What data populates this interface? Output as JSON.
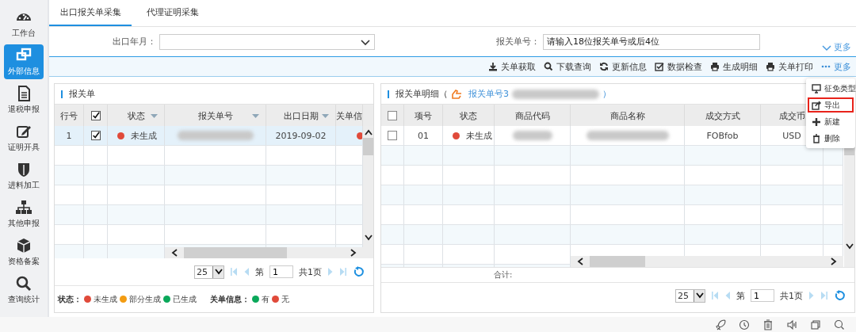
{
  "sidebar": {
    "items": [
      {
        "label": "工作台",
        "selected": false
      },
      {
        "label": "外部信息",
        "selected": true
      },
      {
        "label": "退税申报",
        "selected": false
      },
      {
        "label": "证明开具",
        "selected": false
      },
      {
        "label": "进料加工",
        "selected": false
      },
      {
        "label": "其他申报",
        "selected": false
      },
      {
        "label": "资格备案",
        "selected": false
      },
      {
        "label": "查询统计",
        "selected": false
      }
    ]
  },
  "tabs": [
    {
      "label": "出口报关单采集",
      "selected": true
    },
    {
      "label": "代理证明采集",
      "selected": false
    }
  ],
  "filters": [
    {
      "kind": "select",
      "label": "出口年月："
    },
    {
      "kind": "text",
      "label": "报关单号：",
      "placeholder": "请输入18位报关单号或后4位"
    }
  ],
  "filter_more": "更多",
  "toolbar": {
    "buttons": [
      "关单获取",
      "下载查询",
      "更新信息",
      "数据检查",
      "生成明细",
      "关单打印"
    ],
    "more": "更多"
  },
  "more_menu": {
    "items": [
      {
        "label": "征免类型",
        "highlighted": false
      },
      {
        "label": "导出",
        "highlighted": true
      },
      {
        "label": "新建",
        "highlighted": false
      },
      {
        "label": "删除",
        "highlighted": false
      }
    ]
  },
  "left_panel": {
    "title": "报关单",
    "columns": [
      {
        "label": "行号",
        "kind": "text",
        "sortable": false
      },
      {
        "kind": "checkbox",
        "checked": true,
        "sortable": false
      },
      {
        "label": "状态",
        "kind": "text",
        "sortable": true
      },
      {
        "label": "报关单号",
        "kind": "text",
        "sortable": true
      },
      {
        "label": "出口日期",
        "kind": "text",
        "sortable": true
      },
      {
        "label": "关单信",
        "kind": "text",
        "sortable": false
      }
    ],
    "rows": [
      {
        "row_no": "1",
        "checked": true,
        "selected": true,
        "status": {
          "label": "未生成",
          "color": "#e04a3a"
        },
        "date": "2019-09-02",
        "info": {
          "color": "#e04a3a"
        }
      }
    ],
    "pager": {
      "page_size": "25",
      "page_prefix": "第",
      "page": "1",
      "total": "共1页"
    },
    "legend": {
      "status_label": "状态：",
      "status_items": [
        {
          "label": "未生成",
          "color": "#e04a3a"
        },
        {
          "label": "部分生成",
          "color": "#f39c12"
        },
        {
          "label": "已生成",
          "color": "#0aa85a"
        }
      ],
      "info_label": "关单信息：",
      "info_items": [
        {
          "label": "有",
          "color": "#0aa85a"
        },
        {
          "label": "无",
          "color": "#e04a3a"
        }
      ]
    }
  },
  "right_panel": {
    "title": "报关单明细（",
    "link_prefix": "报关单号3",
    "title_end": "）",
    "columns": [
      {
        "kind": "checkbox",
        "checked": false
      },
      {
        "label": "项号",
        "kind": "text"
      },
      {
        "label": "状态",
        "kind": "text"
      },
      {
        "label": "商品代码",
        "kind": "text"
      },
      {
        "label": "商品名称",
        "kind": "text"
      },
      {
        "label": "成交方式",
        "kind": "text"
      },
      {
        "label": "成交币",
        "kind": "text"
      }
    ],
    "rows": [
      {
        "checked": false,
        "item_no": "01",
        "status": {
          "label": "未生成",
          "color": "#e04a3a"
        },
        "terms": "FOBfob",
        "currency": "USD"
      }
    ],
    "total_label": "合计:",
    "pager": {
      "page_size": "25",
      "page_prefix": "第",
      "page": "1",
      "total": "共1页"
    }
  }
}
